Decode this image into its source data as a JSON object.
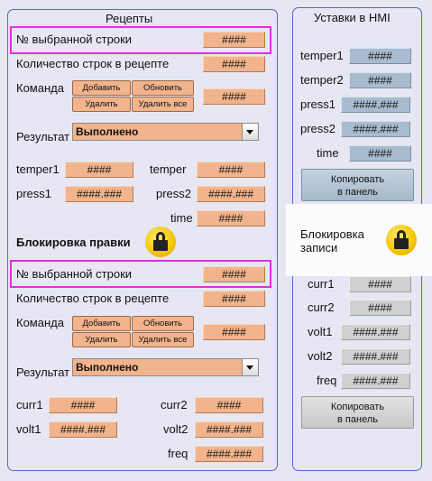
{
  "left": {
    "title": "Рецепты",
    "rec1": {
      "selected_row_label": "№ выбранной строки",
      "selected_row_value": "####",
      "rows_count_label": "Количество строк в рецепте",
      "rows_count_value": "####",
      "command_label": "Команда",
      "cmd_add": "Добавить",
      "cmd_update": "Обновить",
      "cmd_delete": "Удалить",
      "cmd_delete_all": "Удалить все",
      "command_value": "####",
      "result_label": "Результат",
      "result_value": "Выполнено",
      "temper1_label": "temper1",
      "temper1_value": "####",
      "temper_label": "temper",
      "temper_value": "####",
      "press1_label": "press1",
      "press1_value": "####.###",
      "press2_label": "press2",
      "press2_value": "####.###",
      "time_label": "time",
      "time_value": "####"
    },
    "lock_title": "Блокировка правки",
    "rec2": {
      "selected_row_label": "№ выбранной строки",
      "selected_row_value": "####",
      "rows_count_label": "Количество строк в рецепте",
      "rows_count_value": "####",
      "command_label": "Команда",
      "cmd_add": "Добавить",
      "cmd_update": "Обновить",
      "cmd_delete": "Удалить",
      "cmd_delete_all": "Удалить все",
      "command_value": "####",
      "result_label": "Результат",
      "result_value": "Выполнено",
      "curr1_label": "curr1",
      "curr1_value": "####",
      "curr2_label": "curr2",
      "curr2_value": "####",
      "volt1_label": "volt1",
      "volt1_value": "####.###",
      "volt2_label": "volt2",
      "volt2_value": "####.###",
      "freq_label": "freq",
      "freq_value": "####.###"
    }
  },
  "right": {
    "title": "Уставки в HMI",
    "temper1_label": "temper1",
    "temper1_value": "####",
    "temper2_label": "temper2",
    "temper2_value": "####",
    "press1_label": "press1",
    "press1_value": "####.###",
    "press2_label": "press2",
    "press2_value": "####.###",
    "time_label": "time",
    "time_value": "####",
    "copy_button": "Копировать\nв панель",
    "lock_label": "Блокировка\nзаписи",
    "curr1_label": "curr1",
    "curr1_value": "####",
    "curr2_label": "curr2",
    "curr2_value": "####",
    "volt1_label": "volt1",
    "volt1_value": "####.###",
    "volt2_label": "volt2",
    "volt2_value": "####.###",
    "freq_label": "freq",
    "freq_value": "####.###",
    "copy_button2": "Копировать\nв панель"
  },
  "colors": {
    "field_orange": "#f2b48c",
    "field_blue": "#a9bccf",
    "field_gray": "#cfd0d0",
    "highlight": "#e82be0",
    "panel_border": "#5566cc",
    "lock_yellow": "#f4c500"
  },
  "icons": {
    "lock": "lock-icon"
  }
}
